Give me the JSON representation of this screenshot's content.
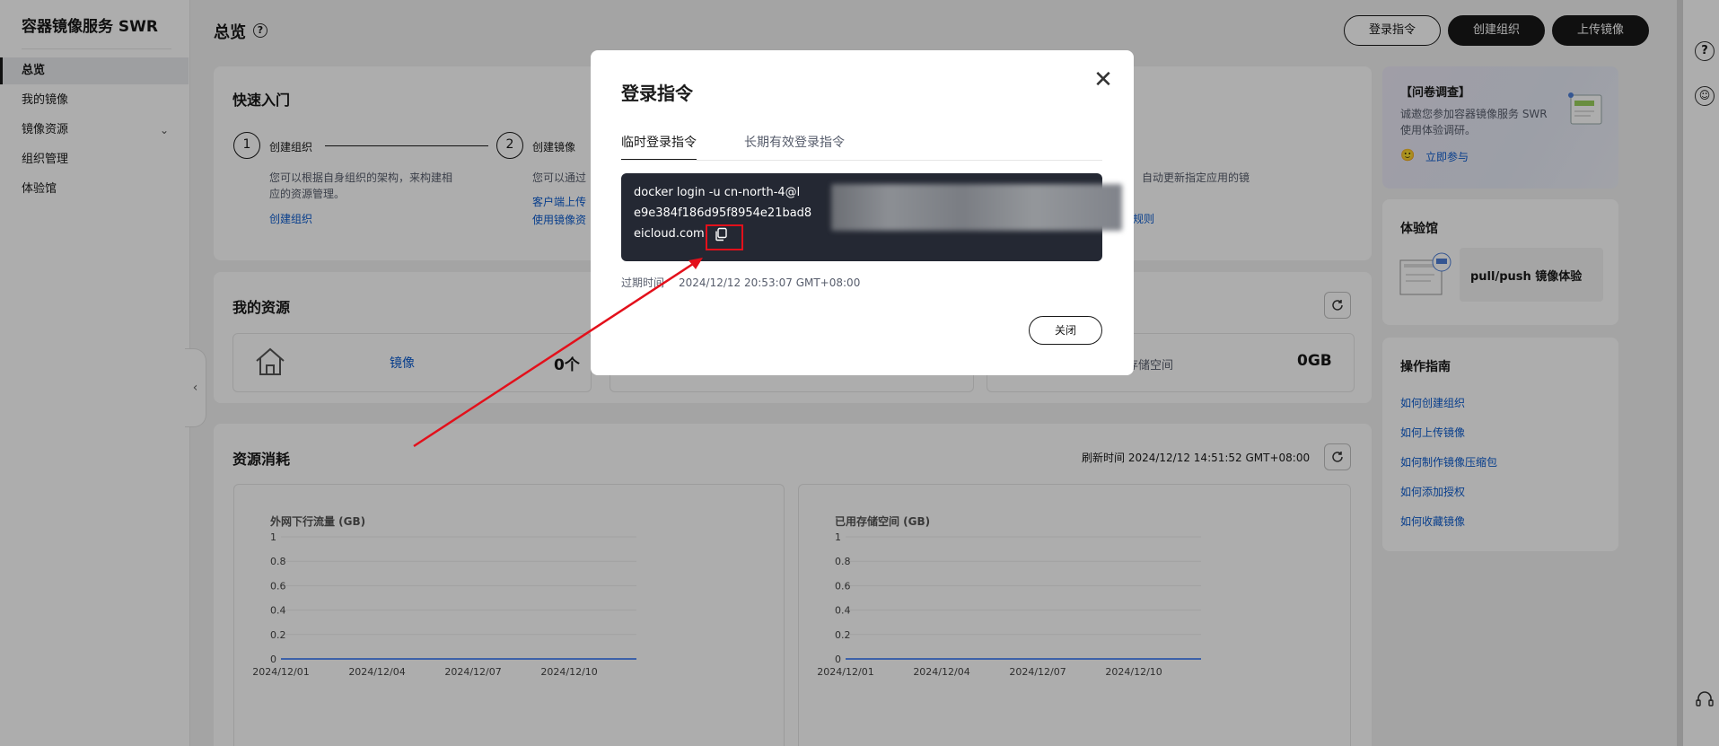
{
  "sidebar": {
    "title": "容器镜像服务 SWR",
    "items": [
      {
        "label": "总览",
        "active": true
      },
      {
        "label": "我的镜像"
      },
      {
        "label": "镜像资源",
        "expandable": true
      },
      {
        "label": "组织管理"
      },
      {
        "label": "体验馆"
      }
    ]
  },
  "header": {
    "title": "总览",
    "help_icon": "?",
    "buttons": {
      "login": "登录指令",
      "create_org": "创建组织",
      "upload": "上传镜像"
    }
  },
  "quick_start": {
    "title": "快速入门",
    "steps": [
      {
        "num": "1",
        "label": "创建组织",
        "desc_line1": "您可以根据自身组织的架构，来构建相",
        "desc_line2": "应的资源管理。",
        "link": "创建组织"
      },
      {
        "num": "2",
        "label": "创建镜像",
        "desc": "您可以通过",
        "link1": "客户端上传",
        "link2": "使用镜像资"
      }
    ],
    "right_desc": "自动更新指定应用的镜",
    "right_link": "规则"
  },
  "my_resources": {
    "title": "我的资源",
    "images": {
      "label": "镜像",
      "value": "0个"
    },
    "storage": {
      "label": "用存储空间",
      "value": "0GB"
    }
  },
  "consumption": {
    "title": "资源消耗",
    "refresh_label": "刷新时间 2024/12/12 14:51:52 GMT+08:00"
  },
  "chart_data": [
    {
      "type": "line",
      "title": "外网下行流量 (GB)",
      "x": [
        "2024/12/01",
        "2024/12/04",
        "2024/12/07",
        "2024/12/10"
      ],
      "series": [
        {
          "values": [
            0,
            0,
            0,
            0
          ]
        }
      ],
      "yticks": [
        "1",
        "0.8",
        "0.6",
        "0.4",
        "0.2",
        "0"
      ],
      "ylim": [
        0,
        1
      ],
      "color": "#5b8ff9"
    },
    {
      "type": "line",
      "title": "已用存储空间 (GB)",
      "x": [
        "2024/12/01",
        "2024/12/04",
        "2024/12/07",
        "2024/12/10"
      ],
      "series": [
        {
          "values": [
            0,
            0,
            0,
            0
          ]
        }
      ],
      "yticks": [
        "1",
        "0.8",
        "0.6",
        "0.4",
        "0.2",
        "0"
      ],
      "ylim": [
        0,
        1
      ],
      "color": "#5b8ff9"
    }
  ],
  "survey": {
    "title": "【问卷调查】",
    "desc_line1": "诚邀您参加容器镜像服务 SWR",
    "desc_line2": "使用体验调研。",
    "link": "立即参与"
  },
  "experience": {
    "title": "体验馆",
    "item_label": "pull/push 镜像体验"
  },
  "guide": {
    "title": "操作指南",
    "links": [
      "如何创建组织",
      "如何上传镜像",
      "如何制作镜像压缩包",
      "如何添加授权",
      "如何收藏镜像"
    ]
  },
  "modal": {
    "title": "登录指令",
    "tabs": {
      "temp": "临时登录指令",
      "long": "长期有效登录指令"
    },
    "code_line1": "docker login -u cn-north-4@l",
    "code_line2": "e9e384f186d95f8954e21bad8",
    "code_line3": "eicloud.com",
    "expire_label": "过期时间",
    "expire_value": "2024/12/12 20:53:07 GMT+08:00",
    "close_btn": "关闭"
  },
  "colors": {
    "accent": "#191919",
    "link": "#0d5ccf",
    "annotation": "#e3101b"
  }
}
